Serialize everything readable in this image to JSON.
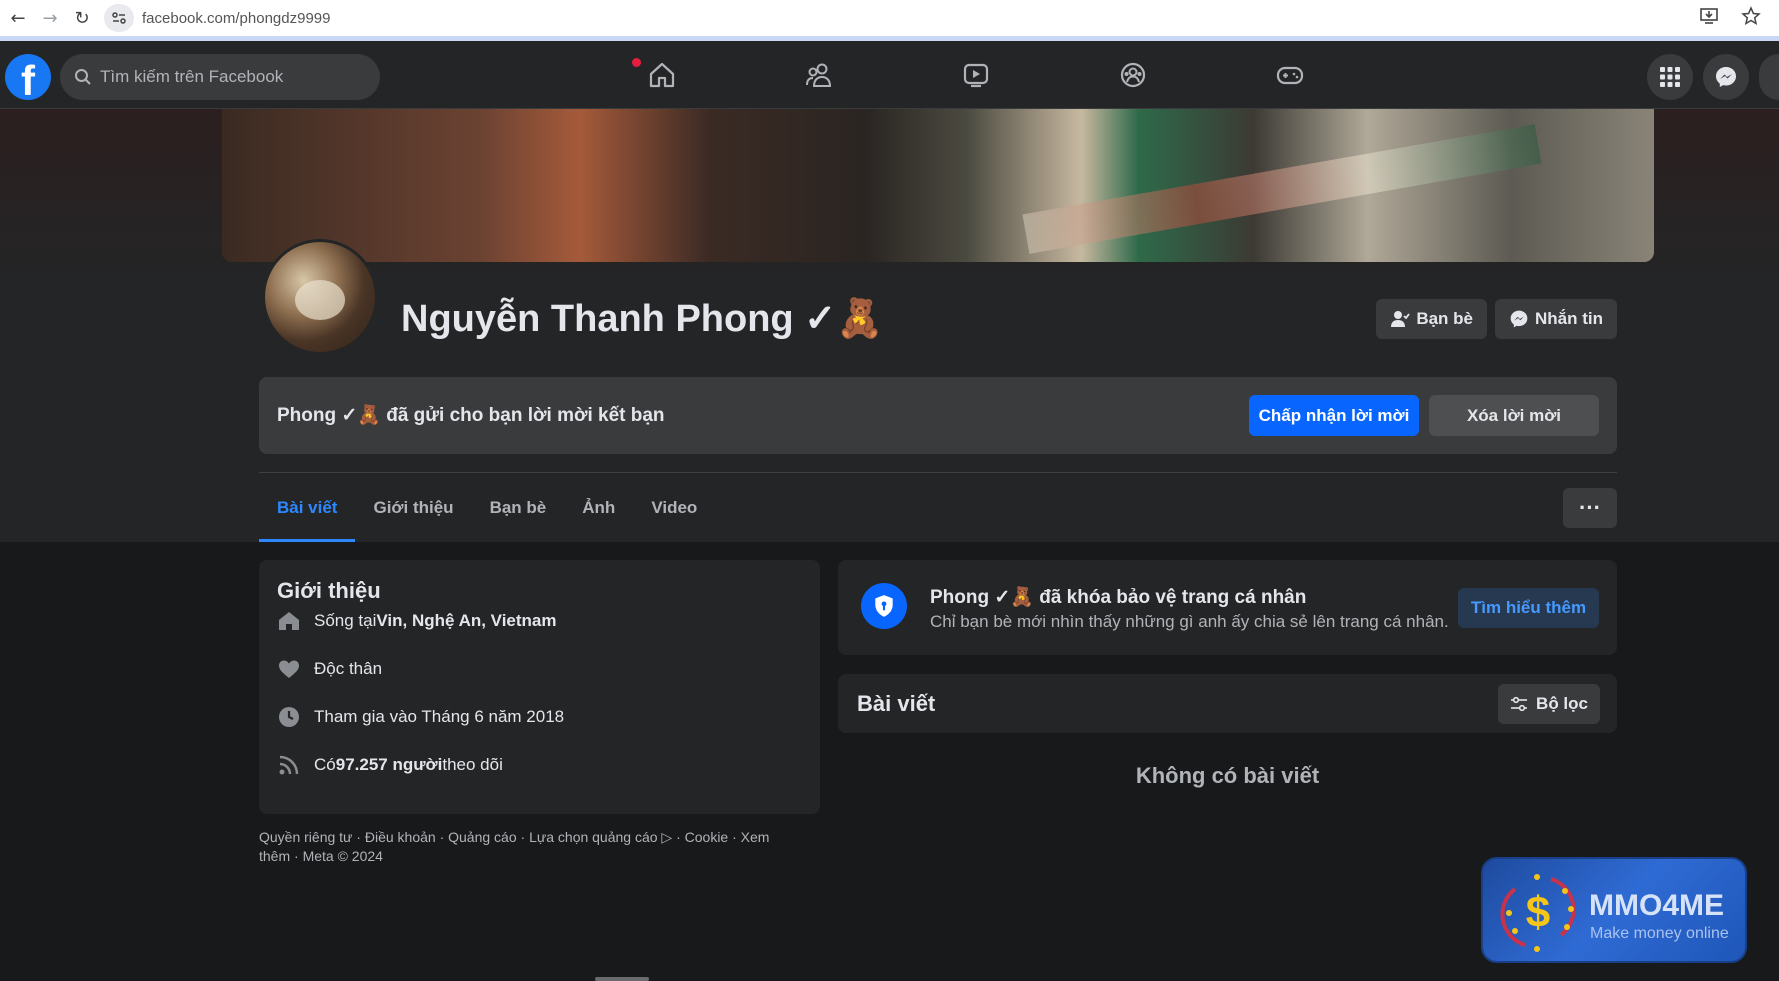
{
  "browser": {
    "url": "facebook.com/phongdz9999"
  },
  "topbar": {
    "logo": "f",
    "search_placeholder": "Tìm kiếm trên Facebook",
    "nav": [
      "home-icon",
      "friends-icon",
      "watch-icon",
      "groups-icon",
      "gaming-icon"
    ],
    "home_notification": true
  },
  "profile": {
    "name": "Nguyễn Thanh Phong ✓🧸",
    "friends_button": "Bạn bè",
    "message_button": "Nhắn tin"
  },
  "friend_request": {
    "text": "Phong ✓🧸 đã gửi cho bạn lời mời kết bạn",
    "accept": "Chấp nhận lời mời",
    "delete": "Xóa lời mời"
  },
  "tabs": [
    {
      "label": "Bài viết",
      "active": true
    },
    {
      "label": "Giới thiệu",
      "active": false
    },
    {
      "label": "Bạn bè",
      "active": false
    },
    {
      "label": "Ảnh",
      "active": false
    },
    {
      "label": "Video",
      "active": false
    }
  ],
  "more_button": "···",
  "intro": {
    "title": "Giới thiệu",
    "lives_prefix": "Sống tại ",
    "lives_place": "Vin, Nghệ An, Vietnam",
    "relationship": "Độc thân",
    "joined": "Tham gia vào Tháng 6 năm 2018",
    "followers_prefix": "Có ",
    "followers_count": "97.257 người",
    "followers_suffix": " theo dõi"
  },
  "footer": {
    "text": "Quyền riêng tư · Điều khoản · Quảng cáo · Lựa chọn quảng cáo ▷ · Cookie · Xem thêm · Meta © 2024"
  },
  "lock_notice": {
    "title": "Phong ✓🧸 đã khóa bảo vệ trang cá nhân",
    "subtitle": "Chỉ bạn bè mới nhìn thấy những gì anh ấy chia sẻ lên trang cá nhân.",
    "button": "Tìm hiểu thêm"
  },
  "posts": {
    "title": "Bài viết",
    "filter": "Bộ lọc",
    "empty": "Không có bài viết"
  },
  "watermark": {
    "title": "MMO4ME",
    "subtitle": "Make money online"
  },
  "colors": {
    "accent": "#0866ff",
    "tab_active": "#2d88ff",
    "background": "#18191a",
    "card": "#242526"
  }
}
